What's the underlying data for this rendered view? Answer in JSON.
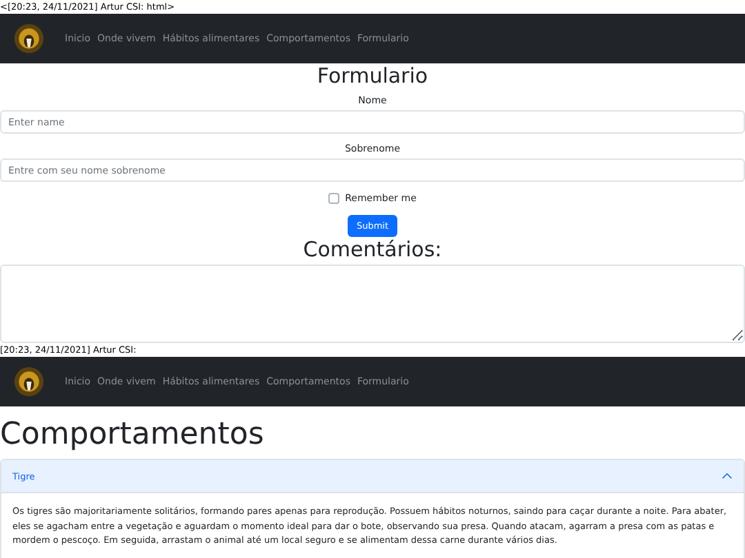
{
  "sections": [
    {
      "caption": "<[20:23, 24/11/2021] Artur CSI: html>",
      "navbar": {
        "links": [
          "Inicio",
          "Onde vivem",
          "Hábitos alimentares",
          "Comportamentos",
          "Formulario"
        ]
      },
      "form": {
        "title": "Formulario",
        "fields": [
          {
            "label": "Nome",
            "placeholder": "Enter name"
          },
          {
            "label": "Sobrenome",
            "placeholder": "Entre com seu nome sobrenome"
          }
        ],
        "remember": {
          "label": "Remember me",
          "checked": false
        },
        "submit": "Submit",
        "comments_title": "Comentários:"
      }
    },
    {
      "caption": "[20:23, 24/11/2021] Artur CSI:",
      "navbar": {
        "links": [
          "Inicio",
          "Onde vivem",
          "Hábitos alimentares",
          "Comportamentos",
          "Formulario"
        ]
      },
      "page": {
        "title": "Comportamentos",
        "accordion": [
          {
            "title": "Tigre",
            "expanded": true,
            "body": "Os tigres são majoritariamente solitários, formando pares apenas para reprodução. Possuem hábitos noturnos, saindo para caçar durante a noite. Para abater, eles se agacham entre a vegetação e aguardam o momento ideal para dar o bote, observando sua presa. Quando atacam, agarram a presa com as patas e mordem o pescoço. Em seguida, arrastam o animal até um local seguro e se alimentam dessa carne durante vários dias."
          }
        ]
      }
    }
  ]
}
